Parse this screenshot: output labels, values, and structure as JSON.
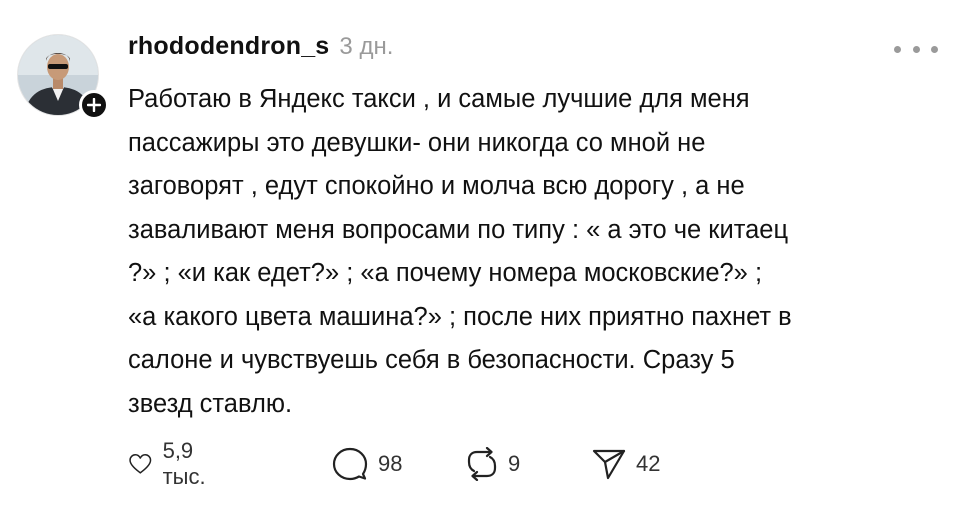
{
  "post": {
    "username": "rhododendron_s",
    "timestamp": "3 дн.",
    "text_lines": [
      "Работаю в Яндекс такси , и самые лучшие для меня",
      "пассажиры это девушки- они никогда со мной не",
      "заговорят , едут спокойно и молча всю дорогу , а не",
      "заваливают меня вопросами по типу : « а это че китаец",
      "?» ; «и как едет?» ; «а почему номера московские?» ;",
      "«а какого цвета машина?» ; после них приятно пахнет в",
      "салоне и чувствуешь себя в безопасности. Сразу 5",
      "звезд ставлю."
    ]
  },
  "actions": {
    "likes": "5,9 тыс.",
    "replies": "98",
    "reposts": "9",
    "shares": "42"
  },
  "icons": {
    "avatar": "user-avatar",
    "follow": "plus-icon",
    "more": "more-icon",
    "like": "heart-icon",
    "reply": "comment-icon",
    "repost": "repost-icon",
    "share": "send-icon"
  },
  "colors": {
    "text": "#111111",
    "muted": "#9a9a9a",
    "badge": "#111111"
  }
}
